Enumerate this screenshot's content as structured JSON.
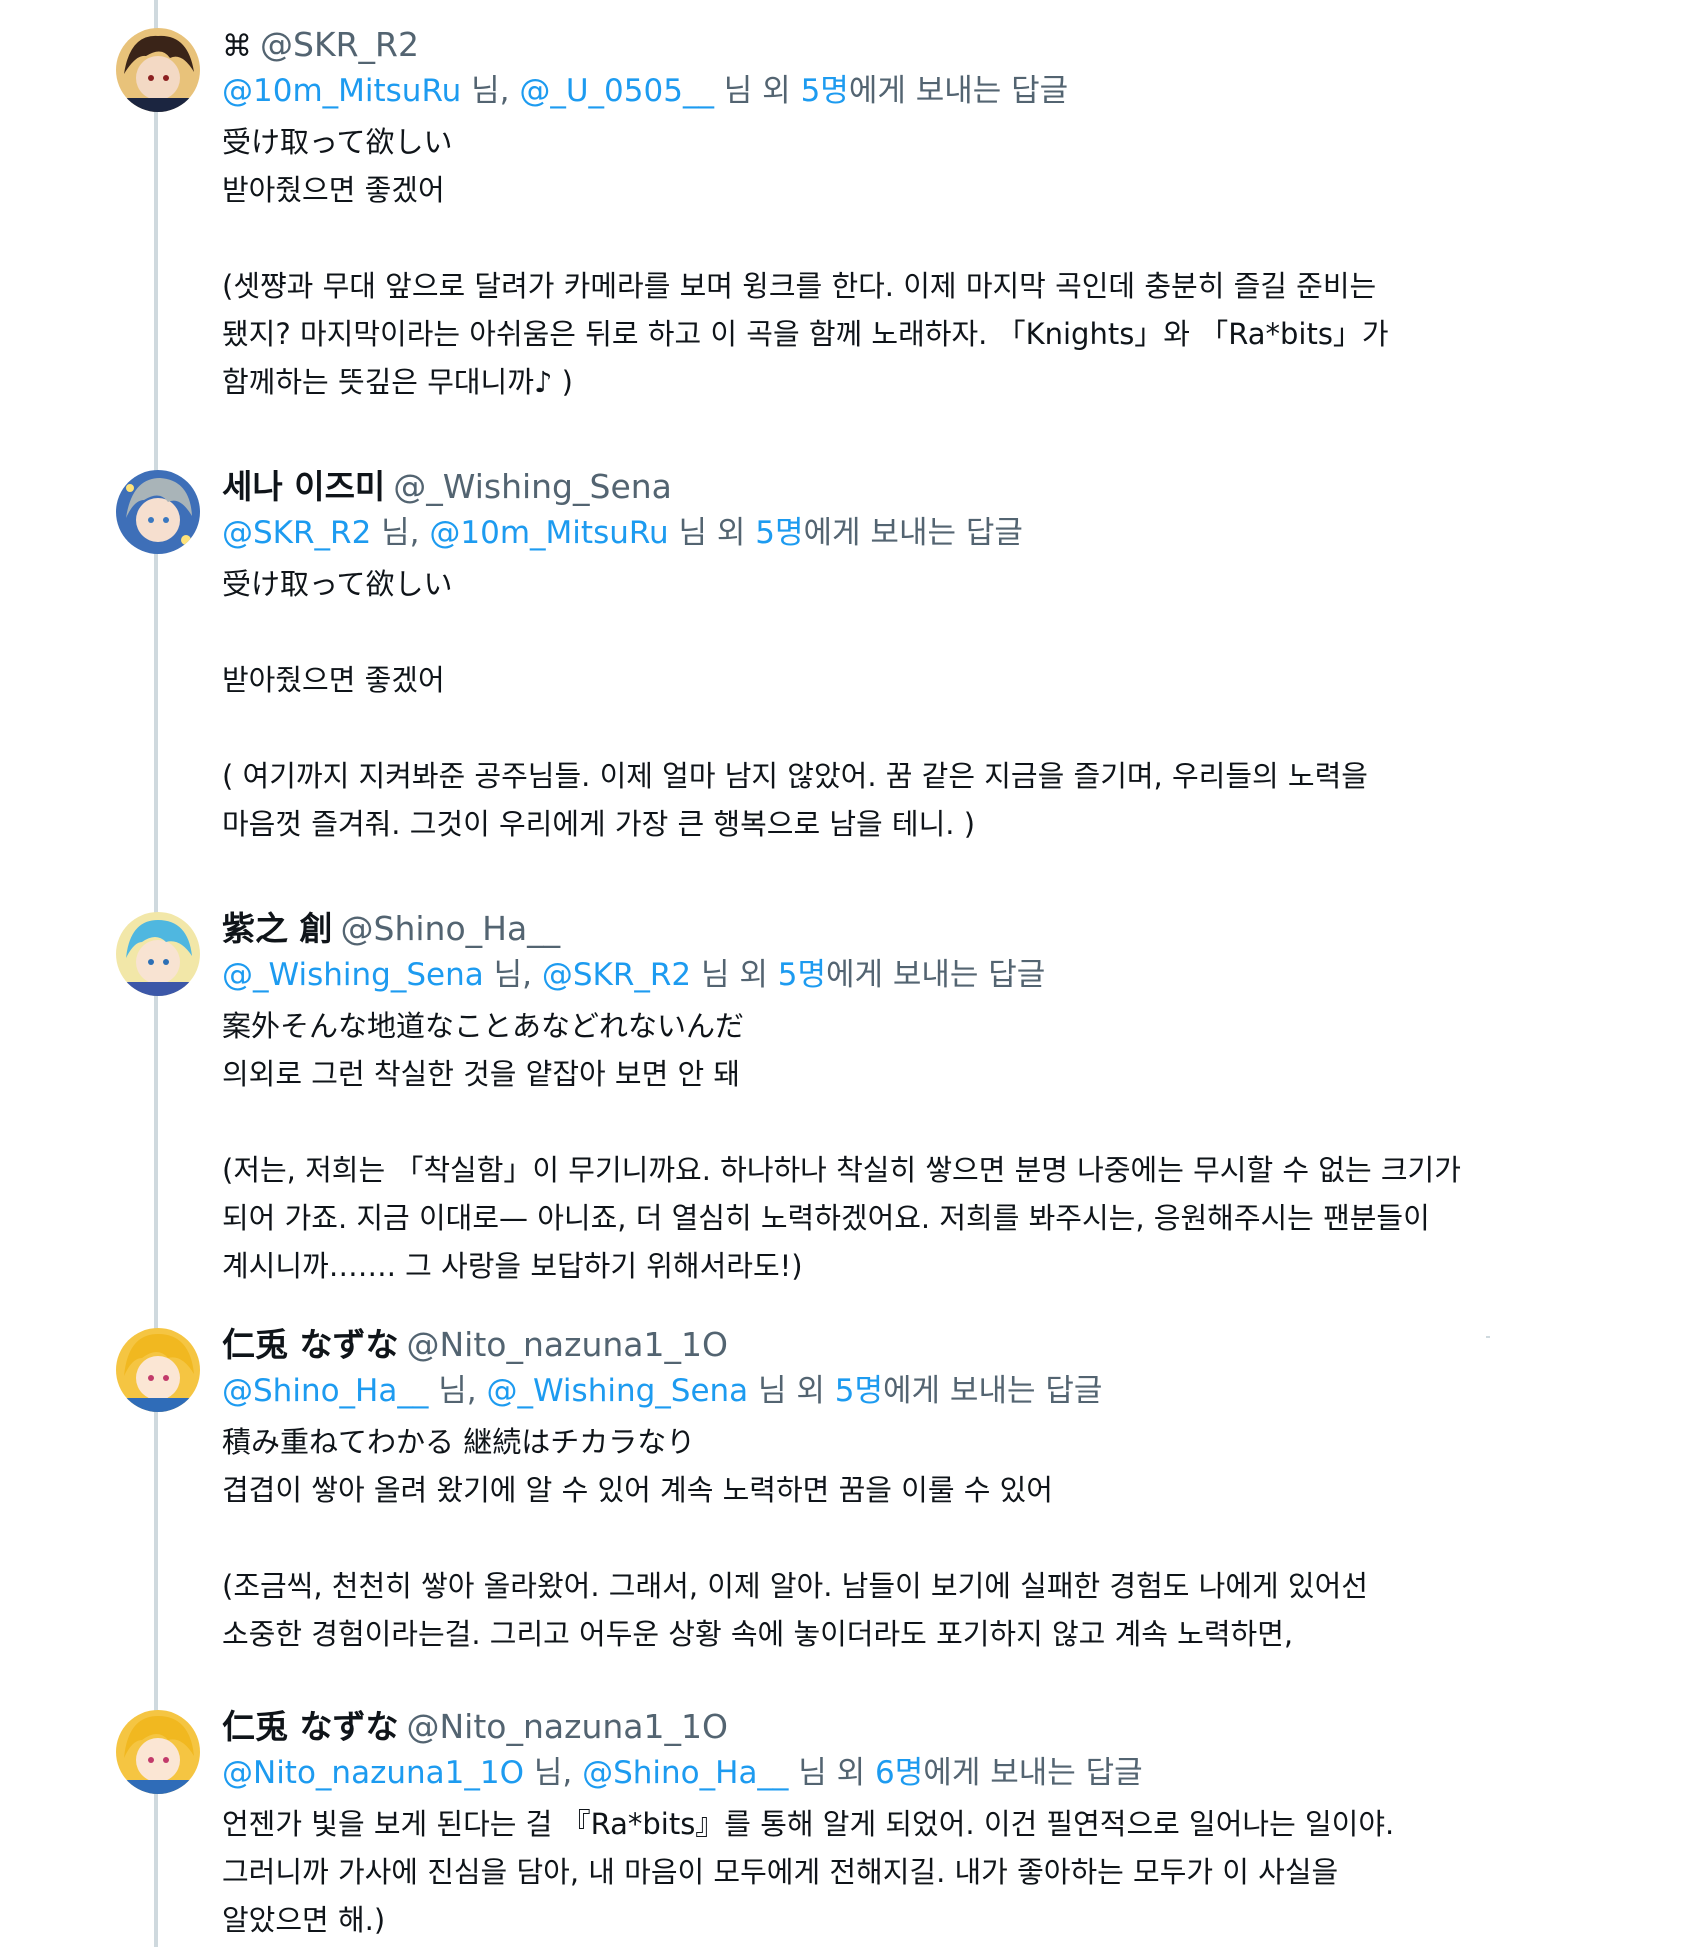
{
  "tweets": [
    {
      "display_name": "",
      "name_symbol": "⌘",
      "handle": "@SKR_R2",
      "reply_to": [
        "@10m_MitsuRu",
        "@_U_0505__"
      ],
      "reply_suffix_1": " 님, ",
      "reply_suffix_2": " 님 외 ",
      "reply_count": "5명",
      "reply_tail": "에게 보내는 답글",
      "lines": [
        "受け取って欲しい",
        "받아줬으면 좋겠어",
        "",
        "(셋쨩과 무대 앞으로 달려가 카메라를 보며 윙크를 한다. 이제 마지막 곡인데 충분히 즐길 준비는",
        "됐지? 마지막이라는 아쉬움은 뒤로 하고 이 곡을 함께 노래하자. 「Knights」와 「Ra*bits」가",
        "함께하는 뜻깊은 무대니까♪ )"
      ]
    },
    {
      "display_name": "세나 이즈미",
      "handle": "@_Wishing_Sena",
      "reply_to": [
        "@SKR_R2",
        "@10m_MitsuRu"
      ],
      "reply_suffix_1": " 님, ",
      "reply_suffix_2": " 님 외 ",
      "reply_count": "5명",
      "reply_tail": "에게 보내는 답글",
      "lines": [
        "受け取って欲しい",
        "",
        "받아줬으면 좋겠어",
        "",
        "( 여기까지 지켜봐준 공주님들. 이제 얼마 남지 않았어. 꿈 같은 지금을 즐기며, 우리들의 노력을",
        "마음껏 즐겨줘. 그것이 우리에게 가장 큰 행복으로 남을 테니. )"
      ]
    },
    {
      "display_name": "紫之 創",
      "handle": "@Shino_Ha__",
      "reply_to": [
        "@_Wishing_Sena",
        "@SKR_R2"
      ],
      "reply_suffix_1": " 님, ",
      "reply_suffix_2": " 님 외 ",
      "reply_count": "5명",
      "reply_tail": "에게 보내는 답글",
      "lines": [
        "案外そんな地道なことあなどれないんだ",
        "의외로 그런 착실한 것을 얕잡아 보면 안 돼",
        "",
        "(저는, 저희는 「착실함」이 무기니까요. 하나하나 착실히 쌓으면 분명 나중에는 무시할 수 없는 크기가",
        "되어 가죠. 지금 이대로— 아니죠, 더 열심히 노력하겠어요. 저희를 봐주시는, 응원해주시는 팬분들이",
        "계시니까……. 그 사랑을 보답하기 위해서라도!)"
      ]
    },
    {
      "display_name": "仁兎 なずな",
      "handle": "@Nito_nazuna1_1O",
      "reply_to": [
        "@Shino_Ha__",
        "@_Wishing_Sena"
      ],
      "reply_suffix_1": " 님, ",
      "reply_suffix_2": " 님 외 ",
      "reply_count": "5명",
      "reply_tail": "에게 보내는 답글",
      "lines": [
        "積み重ねてわかる 継続はチカラなり",
        "겹겹이 쌓아 올려 왔기에 알 수 있어 계속 노력하면 꿈을 이룰 수 있어",
        "",
        "(조금씩, 천천히 쌓아 올라왔어. 그래서, 이제 알아. 남들이 보기에 실패한 경험도 나에게 있어선",
        "소중한 경험이라는걸. 그리고 어두운 상황 속에 놓이더라도 포기하지 않고 계속 노력하면,"
      ]
    },
    {
      "display_name": "仁兎 なずな",
      "handle": "@Nito_nazuna1_1O",
      "reply_to": [
        "@Nito_nazuna1_1O",
        "@Shino_Ha__"
      ],
      "reply_suffix_1": " 님, ",
      "reply_suffix_2": " 님 외 ",
      "reply_count": "6명",
      "reply_tail": "에게 보내는 답글",
      "lines": [
        "언젠가 빛을 보게 된다는 걸 『Ra*bits』를 통해 알게 되었어. 이건 필연적으로 일어나는 일이야.",
        "그러니까 가사에 진심을 담아, 내 마음이 모두에게 전해지길. 내가 좋아하는 모두가 이 사실을",
        "알았으면 해.)"
      ]
    }
  ],
  "colors": {
    "link": "#1d9bf0",
    "secondary": "#536471",
    "text": "#0f1419",
    "thread_line": "#cfd9de"
  }
}
